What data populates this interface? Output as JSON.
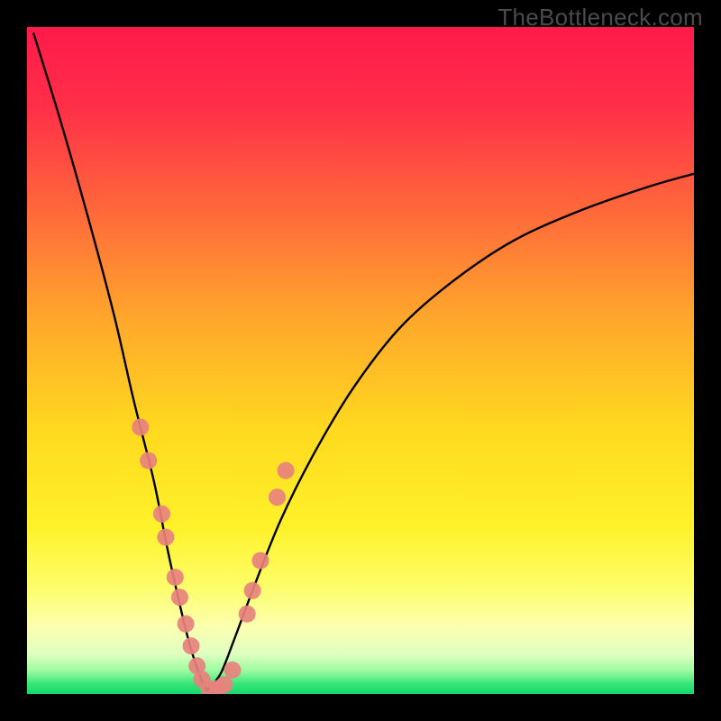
{
  "watermark": "TheBottleneck.com",
  "colors": {
    "frame": "#000000",
    "curve": "#000000",
    "dots": "#e8817e",
    "gradient_stops": [
      {
        "offset": 0.0,
        "color": "#ff1a4a"
      },
      {
        "offset": 0.12,
        "color": "#ff2f48"
      },
      {
        "offset": 0.28,
        "color": "#ff6a3a"
      },
      {
        "offset": 0.44,
        "color": "#ffa82b"
      },
      {
        "offset": 0.6,
        "color": "#ffd81f"
      },
      {
        "offset": 0.75,
        "color": "#fff22a"
      },
      {
        "offset": 0.84,
        "color": "#fdfd6a"
      },
      {
        "offset": 0.9,
        "color": "#fbffb0"
      },
      {
        "offset": 0.94,
        "color": "#dfffc0"
      },
      {
        "offset": 0.965,
        "color": "#9dfba0"
      },
      {
        "offset": 0.985,
        "color": "#36e579"
      },
      {
        "offset": 1.0,
        "color": "#16d86b"
      }
    ]
  },
  "chart_data": {
    "type": "line",
    "title": "",
    "xlabel": "",
    "ylabel": "",
    "xlim": [
      0,
      100
    ],
    "ylim": [
      0,
      100
    ],
    "note": "V-shaped bottleneck curve; y ≈ mismatch magnitude (0 = ideal). Left branch (x ≈ 0–27) and right branch (x ≈ 27–100). Values are visual placements read from the image (0 = bottom, 100 = top).",
    "series": [
      {
        "name": "left-branch",
        "x": [
          1,
          5,
          9,
          13,
          16,
          19,
          21,
          23,
          24.5,
          26,
          27
        ],
        "y": [
          99,
          86,
          72,
          57,
          44,
          32,
          22,
          13,
          7,
          2.5,
          0.5
        ]
      },
      {
        "name": "right-branch",
        "x": [
          27,
          29,
          31,
          34,
          38,
          43,
          49,
          56,
          64,
          73,
          83,
          93,
          100
        ],
        "y": [
          0.5,
          3,
          8,
          16,
          26,
          36,
          46,
          55,
          62,
          68,
          72.5,
          76,
          78
        ]
      }
    ],
    "markers": {
      "name": "highlighted-points",
      "color": "#e8817e",
      "points": [
        {
          "x": 17.0,
          "y": 40
        },
        {
          "x": 18.2,
          "y": 35
        },
        {
          "x": 20.2,
          "y": 27
        },
        {
          "x": 20.8,
          "y": 23.5
        },
        {
          "x": 22.2,
          "y": 17.5
        },
        {
          "x": 22.9,
          "y": 14.5
        },
        {
          "x": 23.8,
          "y": 10.5
        },
        {
          "x": 24.6,
          "y": 7.2
        },
        {
          "x": 25.5,
          "y": 4.2
        },
        {
          "x": 26.2,
          "y": 2.2
        },
        {
          "x": 27.3,
          "y": 0.8
        },
        {
          "x": 28.6,
          "y": 0.8
        },
        {
          "x": 29.6,
          "y": 1.4
        },
        {
          "x": 30.8,
          "y": 3.6
        },
        {
          "x": 33.0,
          "y": 12.0
        },
        {
          "x": 33.8,
          "y": 15.5
        },
        {
          "x": 35.0,
          "y": 20.0
        },
        {
          "x": 37.5,
          "y": 29.5
        },
        {
          "x": 38.8,
          "y": 33.5
        }
      ]
    }
  }
}
